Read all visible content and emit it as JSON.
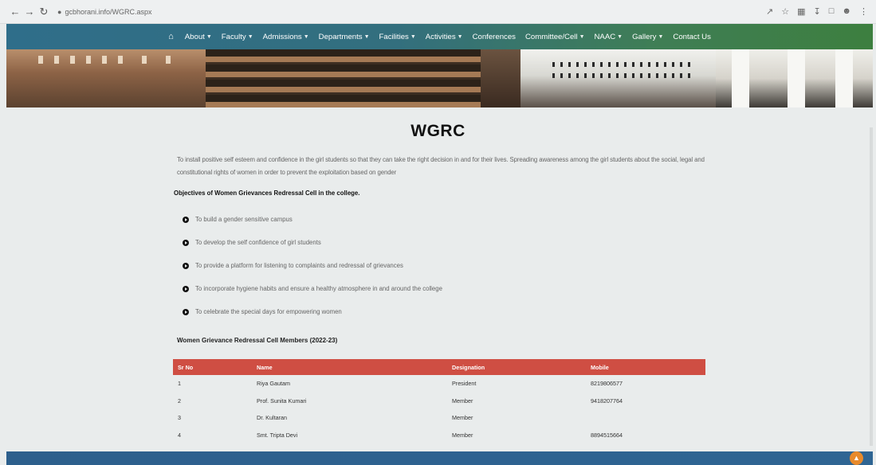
{
  "browser": {
    "url": "gcbhorani.info/WGRC.aspx"
  },
  "nav": {
    "items": [
      {
        "label": "About",
        "dropdown": true
      },
      {
        "label": "Faculty",
        "dropdown": true
      },
      {
        "label": "Admissions",
        "dropdown": true
      },
      {
        "label": "Departments",
        "dropdown": true
      },
      {
        "label": "Facilities",
        "dropdown": true
      },
      {
        "label": "Activities",
        "dropdown": true
      },
      {
        "label": "Conferences",
        "dropdown": false
      },
      {
        "label": "Committee/Cell",
        "dropdown": true
      },
      {
        "label": "NAAC",
        "dropdown": true
      },
      {
        "label": "Gallery",
        "dropdown": true
      },
      {
        "label": "Contact Us",
        "dropdown": false
      }
    ]
  },
  "page": {
    "title": "WGRC",
    "intro": "To install positive self esteem and confidence in the girl students so that they can take the right decision in and for their lives. Spreading awareness among the girl students about the social, legal and constitutional rights of women in order to prevent the exploitation based on gender",
    "objectives_heading": "Objectives of Women Grievances Redressal Cell in the college.",
    "objectives": [
      "To build a gender sensitive campus",
      "To develop the self confidence of girl students",
      "To provide a platform for listening to complaints and redressal of grievances",
      "To incorporate hygiene habits and ensure a healthy atmosphere in and around the college",
      "To celebrate the special days for empowering women"
    ],
    "members_title": "Women Grievance Redressal Cell Members (2022-23)",
    "members_headers": {
      "sr": "Sr No",
      "name": "Name",
      "designation": "Designation",
      "mobile": "Mobile"
    },
    "members": [
      {
        "sr": "1",
        "name": "Riya Gautam",
        "designation": "President",
        "mobile": "8219806577"
      },
      {
        "sr": "2",
        "name": "Prof. Sunita Kumari",
        "designation": "Member",
        "mobile": "9418207764"
      },
      {
        "sr": "3",
        "name": "Dr. Kultaran",
        "designation": "Member",
        "mobile": ""
      },
      {
        "sr": "4",
        "name": "Smt. Tripta Devi",
        "designation": "Member",
        "mobile": "8894515664"
      }
    ]
  },
  "colors": {
    "nav_start": "#2f6e8a",
    "nav_end": "#3d7f3f",
    "table_header": "#cf4e43",
    "footer": "#2f6593",
    "scroll_top": "#e88a2b"
  }
}
